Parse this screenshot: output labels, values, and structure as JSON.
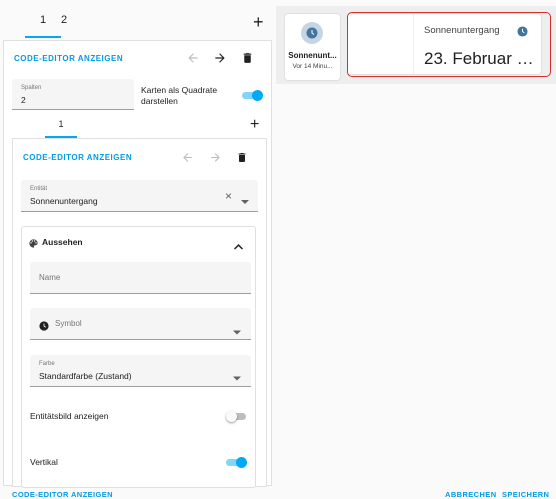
{
  "root_tabs": [
    "1",
    "2"
  ],
  "outer_editor": {
    "code_editor_label": "CODE-EDITOR ANZEIGEN",
    "columns_label": "Spalten",
    "columns_value": "2",
    "square_label": "Karten als Quadrate darstellen",
    "square_on": true
  },
  "inner_tabs": [
    "1"
  ],
  "inner_editor": {
    "code_editor_label": "CODE-EDITOR ANZEIGEN",
    "entity_label": "Entität",
    "entity_value": "Sonnenuntergang",
    "appearance_title": "Aussehen",
    "name_placeholder": "Name",
    "symbol_placeholder": "Symbol",
    "color_label": "Farbe",
    "color_value": "Standardfarbe (Zustand)",
    "entity_image_label": "Entitätsbild anzeigen",
    "entity_image_on": false,
    "vertical_label": "Vertikal",
    "vertical_on": true
  },
  "footer": {
    "code_editor": "CODE-EDITOR ANZEIGEN",
    "cancel": "ABBRECHEN",
    "save": "SPEICHERN"
  },
  "preview": {
    "tile_title": "Sonnenunt...",
    "tile_sub": "Vor 14 Minu...",
    "entity_name": "Sonnenuntergang",
    "entity_value": "23. Februar 2...",
    "icon_color": "#44739e",
    "highlight_color": "#d32f2f"
  },
  "icons": [
    "arrow-back-icon",
    "arrow-forward-icon",
    "delete-icon",
    "add-icon",
    "clear-icon",
    "dropdown-icon",
    "palette-icon",
    "chevron-up-icon",
    "clock-icon"
  ]
}
